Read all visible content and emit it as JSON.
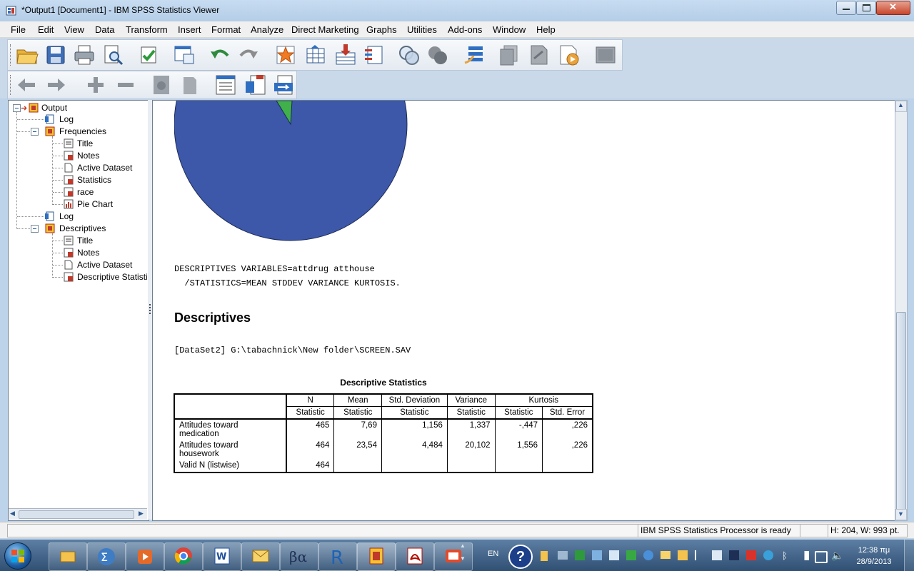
{
  "window": {
    "title": "*Output1 [Document1] - IBM SPSS Statistics Viewer"
  },
  "menu": {
    "items": [
      "File",
      "Edit",
      "View",
      "Data",
      "Transform",
      "Insert",
      "Format",
      "Analyze",
      "Direct Marketing",
      "Graphs",
      "Utilities",
      "Add-ons",
      "Window",
      "Help"
    ]
  },
  "toolbar1": {
    "icons": [
      "open-icon",
      "save-icon",
      "print-icon",
      "print-preview-icon",
      "export-icon",
      "recall-dialog-icon",
      "undo-icon",
      "redo-icon",
      "goto-data-icon",
      "goto-case-icon",
      "goto-variable-icon",
      "variables-icon",
      "use-sets-icon",
      "show-all-variables-icon",
      "spelling-icon",
      "designate-window-icon",
      "select-last-output-icon",
      "create-edit-autoscript-icon",
      "run-script-icon",
      "blank-icon"
    ]
  },
  "toolbar2": {
    "icons": [
      "promote-icon",
      "demote-icon",
      "expand-icon",
      "collapse-icon",
      "show-icon",
      "hide-icon",
      "insert-heading-icon",
      "insert-title-icon",
      "insert-text-icon"
    ]
  },
  "outline": {
    "root": "Output",
    "items": [
      {
        "label": "Log",
        "level": 1
      },
      {
        "label": "Frequencies",
        "level": 1
      },
      {
        "label": "Title",
        "level": 2
      },
      {
        "label": "Notes",
        "level": 2
      },
      {
        "label": "Active Dataset",
        "level": 2
      },
      {
        "label": "Statistics",
        "level": 2
      },
      {
        "label": "race",
        "level": 2
      },
      {
        "label": "Pie Chart",
        "level": 2
      },
      {
        "label": "Log",
        "level": 1
      },
      {
        "label": "Descriptives",
        "level": 1
      },
      {
        "label": "Title",
        "level": 2
      },
      {
        "label": "Notes",
        "level": 2
      },
      {
        "label": "Active Dataset",
        "level": 2
      },
      {
        "label": "Descriptive Statistics",
        "level": 2
      }
    ]
  },
  "content": {
    "syntax_line1": "DESCRIPTIVES VARIABLES=attdrug atthouse",
    "syntax_line2": "  /STATISTICS=MEAN STDDEV VARIANCE KURTOSIS.",
    "heading": "Descriptives",
    "dataset_line": "[DataSet2] G:\\tabachnick\\New folder\\SCREEN.SAV",
    "pie_colors": {
      "main": "#3d57a9",
      "slice": "#3fb04a"
    }
  },
  "table": {
    "title": "Descriptive Statistics",
    "header1": [
      "N",
      "Mean",
      "Std. Deviation",
      "Variance",
      "Kurtosis"
    ],
    "header2": [
      "Statistic",
      "Statistic",
      "Statistic",
      "Statistic",
      "Statistic",
      "Std. Error"
    ],
    "rows": [
      {
        "label1": "Attitudes toward",
        "label2": "medication",
        "cells": [
          "465",
          "7,69",
          "1,156",
          "1,337",
          "-,447",
          ",226"
        ]
      },
      {
        "label1": "Attitudes toward",
        "label2": "housework",
        "cells": [
          "464",
          "23,54",
          "4,484",
          "20,102",
          "1,556",
          ",226"
        ]
      },
      {
        "label1": "Valid N (listwise)",
        "label2": "",
        "cells": [
          "464",
          "",
          "",
          "",
          "",
          ""
        ]
      }
    ]
  },
  "status": {
    "processor": "IBM SPSS Statistics Processor is ready",
    "dimensions": "H: 204, W: 993 pt."
  },
  "taskbar": {
    "language": "EN",
    "time": "12:38 πμ",
    "date": "28/9/2013"
  }
}
